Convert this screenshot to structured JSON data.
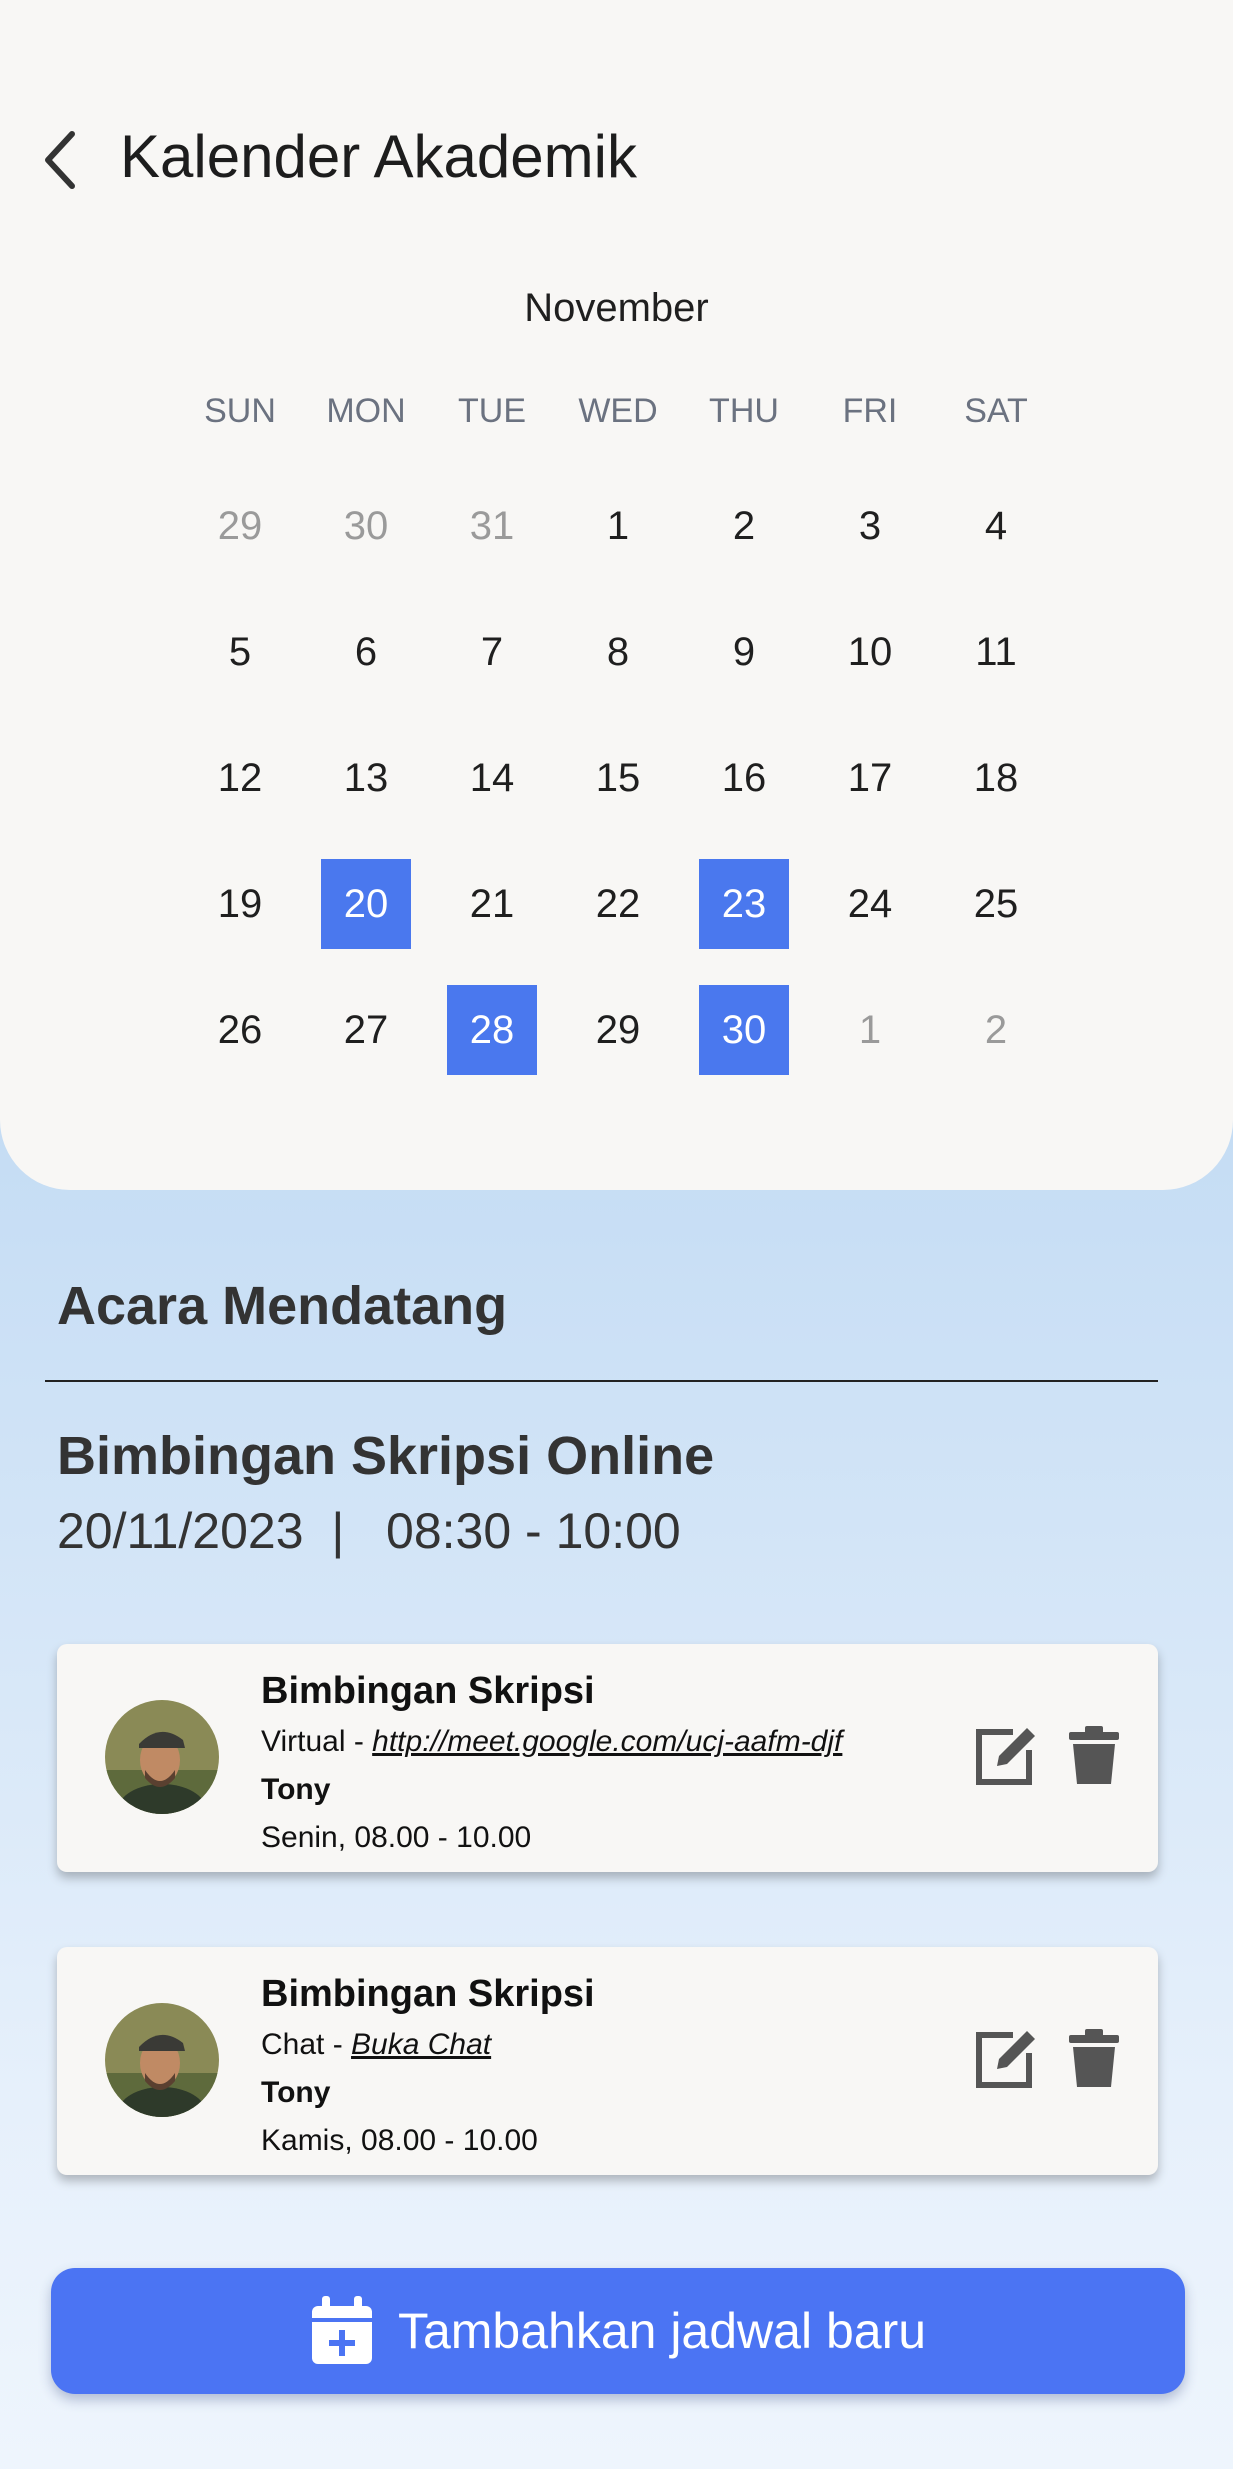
{
  "header": {
    "title": "Kalender Akademik"
  },
  "calendar": {
    "month": "November",
    "weekdays": [
      "SUN",
      "MON",
      "TUE",
      "WED",
      "THU",
      "FRI",
      "SAT"
    ],
    "days": [
      {
        "n": "29",
        "muted": true
      },
      {
        "n": "30",
        "muted": true
      },
      {
        "n": "31",
        "muted": true
      },
      {
        "n": "1"
      },
      {
        "n": "2"
      },
      {
        "n": "3"
      },
      {
        "n": "4"
      },
      {
        "n": "5"
      },
      {
        "n": "6"
      },
      {
        "n": "7"
      },
      {
        "n": "8"
      },
      {
        "n": "9"
      },
      {
        "n": "10"
      },
      {
        "n": "11"
      },
      {
        "n": "12"
      },
      {
        "n": "13"
      },
      {
        "n": "14"
      },
      {
        "n": "15"
      },
      {
        "n": "16"
      },
      {
        "n": "17"
      },
      {
        "n": "18"
      },
      {
        "n": "19"
      },
      {
        "n": "20",
        "marked": true
      },
      {
        "n": "21"
      },
      {
        "n": "22"
      },
      {
        "n": "23",
        "marked": true
      },
      {
        "n": "24"
      },
      {
        "n": "25"
      },
      {
        "n": "26"
      },
      {
        "n": "27"
      },
      {
        "n": "28",
        "marked": true
      },
      {
        "n": "29"
      },
      {
        "n": "30",
        "marked": true
      },
      {
        "n": "1",
        "muted": true
      },
      {
        "n": "2",
        "muted": true
      }
    ],
    "accent_color": "#4a78ee"
  },
  "upcoming": {
    "section_title": "Acara Mendatang",
    "event_title": "Bimbingan Skripsi Online",
    "event_date": "20/11/2023",
    "event_separator": "|",
    "event_time": "08:30 - 10:00"
  },
  "cards": [
    {
      "title": "Bimbingan Skripsi",
      "mode": "Virtual - ",
      "link": "http://meet.google.com/ucj-aafm-djf",
      "name": "Tony",
      "schedule": "Senin, 08.00 - 10.00"
    },
    {
      "title": "Bimbingan Skripsi",
      "mode": "Chat - ",
      "link": "Buka Chat",
      "name": "Tony",
      "schedule": "Kamis, 08.00 - 10.00"
    }
  ],
  "add_button": {
    "label": "Tambahkan jadwal baru",
    "color": "#4b74f3"
  }
}
